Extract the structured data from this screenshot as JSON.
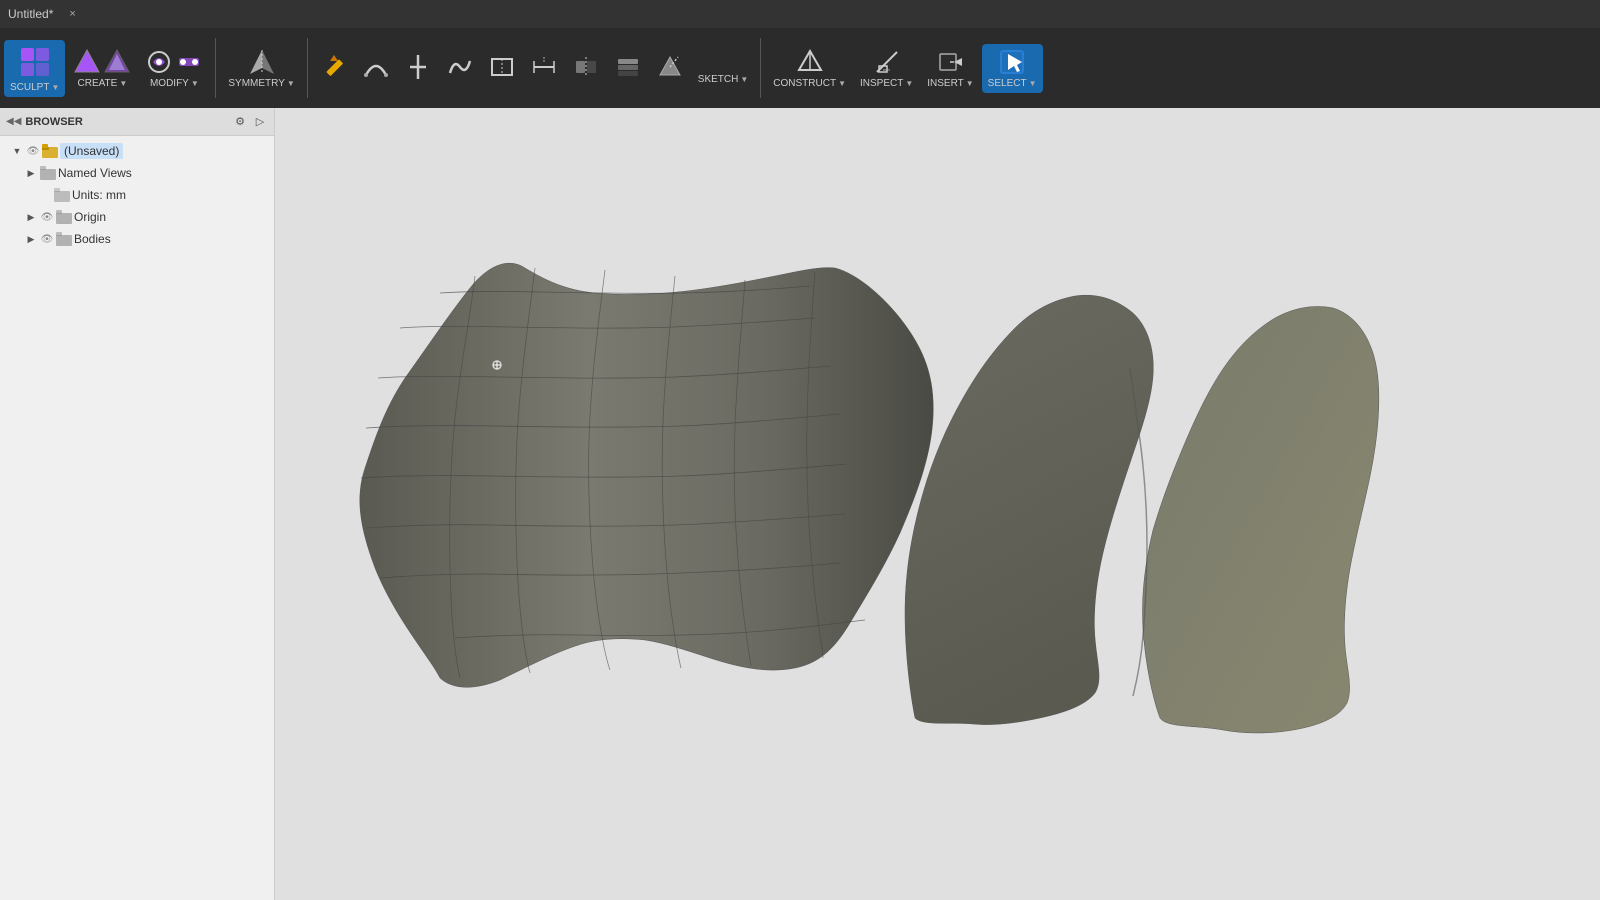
{
  "titleBar": {
    "title": "Untitled*",
    "closeLabel": "×"
  },
  "toolbar": {
    "groups": [
      {
        "id": "sculpt",
        "label": "SCULPT",
        "hasDropdown": true,
        "iconType": "sculpt",
        "active": true
      },
      {
        "id": "create",
        "label": "CREATE",
        "hasDropdown": true,
        "iconType": "create"
      },
      {
        "id": "modify",
        "label": "MODIFY",
        "hasDropdown": true,
        "iconType": "modify"
      },
      {
        "id": "symmetry",
        "label": "SYMMETRY",
        "hasDropdown": true,
        "iconType": "symmetry"
      },
      {
        "id": "sketch-tools",
        "label": "",
        "hasDropdown": false,
        "iconType": "sketch-tools",
        "multi": true
      },
      {
        "id": "sketch",
        "label": "SKETCH",
        "hasDropdown": true,
        "iconType": "sketch"
      },
      {
        "id": "construct",
        "label": "CONSTRUCT",
        "hasDropdown": true,
        "iconType": "construct"
      },
      {
        "id": "inspect",
        "label": "INSPECT",
        "hasDropdown": true,
        "iconType": "inspect"
      },
      {
        "id": "insert",
        "label": "INSERT",
        "hasDropdown": true,
        "iconType": "insert"
      },
      {
        "id": "select",
        "label": "SELECT",
        "hasDropdown": true,
        "iconType": "select",
        "active": true
      }
    ]
  },
  "browser": {
    "title": "BROWSER",
    "tree": [
      {
        "id": "unsaved",
        "label": "(Unsaved)",
        "indent": 0,
        "hasExpand": true,
        "expanded": true,
        "hasEye": true,
        "hasFolder": true,
        "highlighted": true
      },
      {
        "id": "named-views",
        "label": "Named Views",
        "indent": 1,
        "hasExpand": true,
        "expanded": false,
        "hasEye": false,
        "hasFolder": true,
        "highlighted": false
      },
      {
        "id": "units",
        "label": "Units: mm",
        "indent": 2,
        "hasExpand": false,
        "expanded": false,
        "hasEye": false,
        "hasFolder": true,
        "highlighted": false
      },
      {
        "id": "origin",
        "label": "Origin",
        "indent": 1,
        "hasExpand": true,
        "expanded": false,
        "hasEye": true,
        "hasFolder": true,
        "highlighted": false
      },
      {
        "id": "bodies",
        "label": "Bodies",
        "indent": 1,
        "hasExpand": true,
        "expanded": false,
        "hasEye": true,
        "hasFolder": true,
        "highlighted": false
      }
    ]
  },
  "viewport": {
    "backgroundColor": "#e0e0e0"
  }
}
